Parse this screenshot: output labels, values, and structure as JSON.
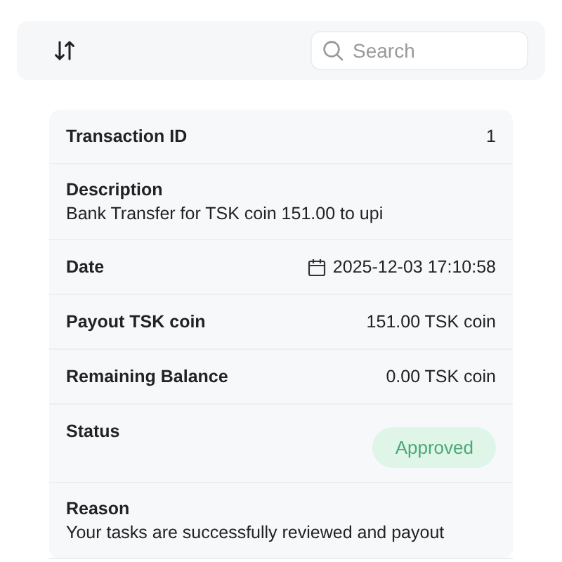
{
  "toolbar": {
    "search": {
      "placeholder": "Search"
    }
  },
  "details": [
    {
      "kind": "inline",
      "label": "Transaction ID",
      "value": "1"
    },
    {
      "kind": "stacked",
      "label": "Description",
      "value": "Bank Transfer for TSK coin 151.00 to upi"
    },
    {
      "kind": "date",
      "label": "Date",
      "value": "2025-12-03 17:10:58"
    },
    {
      "kind": "inline",
      "label": "Payout TSK coin",
      "value": "151.00 TSK coin"
    },
    {
      "kind": "inline",
      "label": "Remaining Balance",
      "value": "0.00 TSK coin"
    },
    {
      "kind": "badge",
      "label": "Status",
      "value": "Approved"
    },
    {
      "kind": "stacked",
      "label": "Reason",
      "value": "Your tasks are successfully reviewed and payout"
    }
  ]
}
